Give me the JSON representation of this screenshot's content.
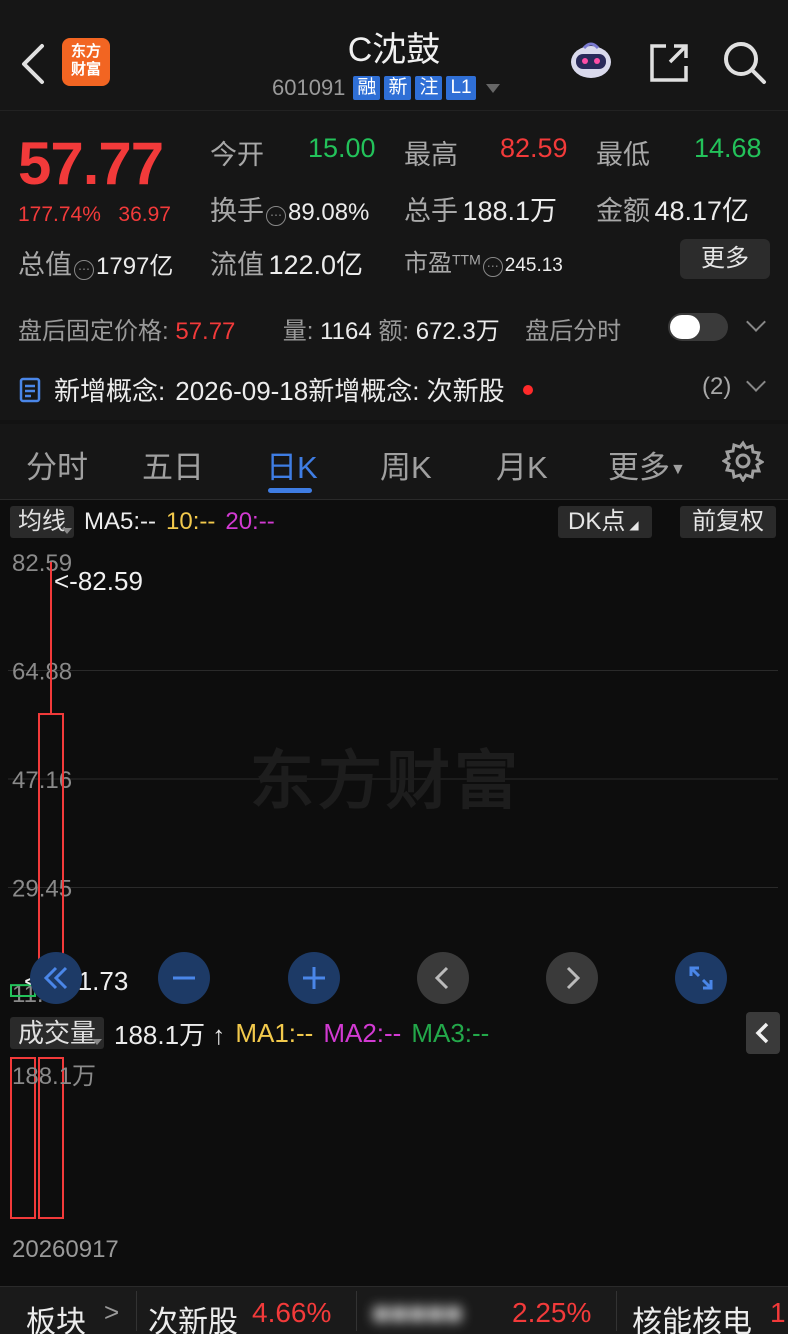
{
  "header": {
    "logo_line1": "东方",
    "logo_line2": "财富",
    "title": "C沈鼓",
    "code": "601091",
    "tags": [
      "融",
      "新",
      "注",
      "L1"
    ]
  },
  "quote": {
    "price": "57.77",
    "change_pct": "177.74%",
    "change_amt": "36.97",
    "open_label": "今开",
    "open": "15.00",
    "high_label": "最高",
    "high": "82.59",
    "low_label": "最低",
    "low": "14.68",
    "turnover_label": "换手",
    "turnover": "89.08%",
    "volume_label": "总手",
    "volume": "188.1万",
    "amount_label": "金额",
    "amount": "48.17亿",
    "mcap_label": "总值",
    "mcap": "1797亿",
    "float_label": "流值",
    "float": "122.0亿",
    "pe_label": "市盈",
    "pe_sup": "TTM",
    "pe": "245.13",
    "more_label": "更多"
  },
  "afterhours": {
    "price_label": "盘后固定价格:",
    "price": "57.77",
    "vol_label": "量:",
    "vol": "1164",
    "amt_label": "额:",
    "amt": "672.3万",
    "timeshare_label": "盘后分时"
  },
  "concept": {
    "label": "新增概念:",
    "text": "2026-09-18新增概念:  次新股",
    "count": "(2)"
  },
  "tabs": [
    {
      "label": "分时"
    },
    {
      "label": "五日"
    },
    {
      "label": "日K"
    },
    {
      "label": "周K"
    },
    {
      "label": "月K"
    },
    {
      "label": "更多"
    }
  ],
  "ma": {
    "selector": "均线",
    "ma5": "MA5:--",
    "ma10": "10:--",
    "ma20": "20:--",
    "dk": "DK点",
    "adjust": "前复权"
  },
  "watermark": "东方财富",
  "chart_data": {
    "type": "candlestick",
    "y_ticks": [
      "82.59",
      "64.88",
      "47.16",
      "29.45",
      "11.73"
    ],
    "ylim": [
      11.73,
      82.59
    ],
    "max_marker": "<-82.59",
    "min_marker": "<---11.73",
    "candles": [
      {
        "open": 13.5,
        "close": 11.73,
        "high": 13.5,
        "low": 11.73
      },
      {
        "open": 15.0,
        "close": 57.77,
        "high": 82.59,
        "low": 14.68
      }
    ]
  },
  "volume": {
    "selector": "成交量",
    "value": "188.1万 ↑",
    "ma1": "MA1:--",
    "ma2": "MA2:--",
    "ma3": "MA3:--",
    "axis_max": "188.1万",
    "bars": [
      1.881,
      1.881
    ],
    "date": "20260917"
  },
  "bottombar": {
    "sector_label": "板块",
    "item1_name": "次新股",
    "item1_pct": "4.66%",
    "item2_pct": "2.25%",
    "item3_name": "核能核电",
    "item3_pct": "1"
  }
}
